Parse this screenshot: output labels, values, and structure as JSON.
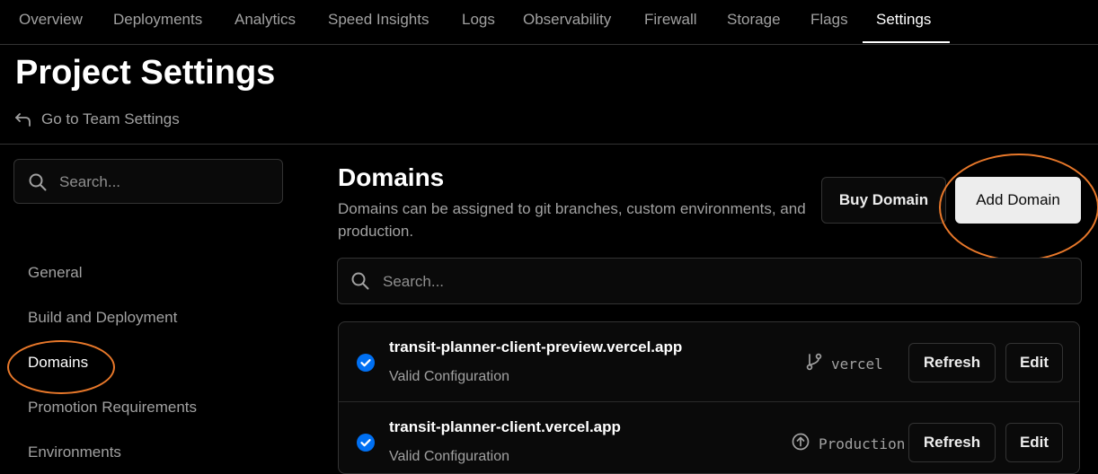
{
  "topnav": {
    "tabs": [
      {
        "label": "Overview"
      },
      {
        "label": "Deployments"
      },
      {
        "label": "Analytics"
      },
      {
        "label": "Speed Insights"
      },
      {
        "label": "Logs"
      },
      {
        "label": "Observability"
      },
      {
        "label": "Firewall"
      },
      {
        "label": "Storage"
      },
      {
        "label": "Flags"
      },
      {
        "label": "Settings",
        "active": true
      }
    ]
  },
  "header": {
    "title": "Project Settings",
    "back_link": "Go to Team Settings",
    "back_icon": "arrow-back-icon"
  },
  "sidebar": {
    "search_placeholder": "Search...",
    "items": [
      {
        "label": "General"
      },
      {
        "label": "Build and Deployment"
      },
      {
        "label": "Domains",
        "active": true
      },
      {
        "label": "Promotion Requirements"
      },
      {
        "label": "Environments"
      }
    ]
  },
  "main": {
    "title": "Domains",
    "description": "Domains can be assigned to git branches, custom environments, and production.",
    "buy_button": "Buy Domain",
    "add_button": "Add Domain",
    "search_placeholder": "Search...",
    "domains": [
      {
        "name": "transit-planner-client-preview.vercel.app",
        "status": "Valid Configuration",
        "target": "vercel",
        "target_icon": "git-branch-icon",
        "refresh_label": "Refresh",
        "edit_label": "Edit"
      },
      {
        "name": "transit-planner-client.vercel.app",
        "status": "Valid Configuration",
        "target": "Production",
        "target_icon": "production-arrow-icon",
        "refresh_label": "Refresh",
        "edit_label": "Edit"
      }
    ]
  },
  "colors": {
    "background": "#000000",
    "accent_check": "#0070f3",
    "annotation_circle": "#e8782a",
    "border": "#333333"
  }
}
